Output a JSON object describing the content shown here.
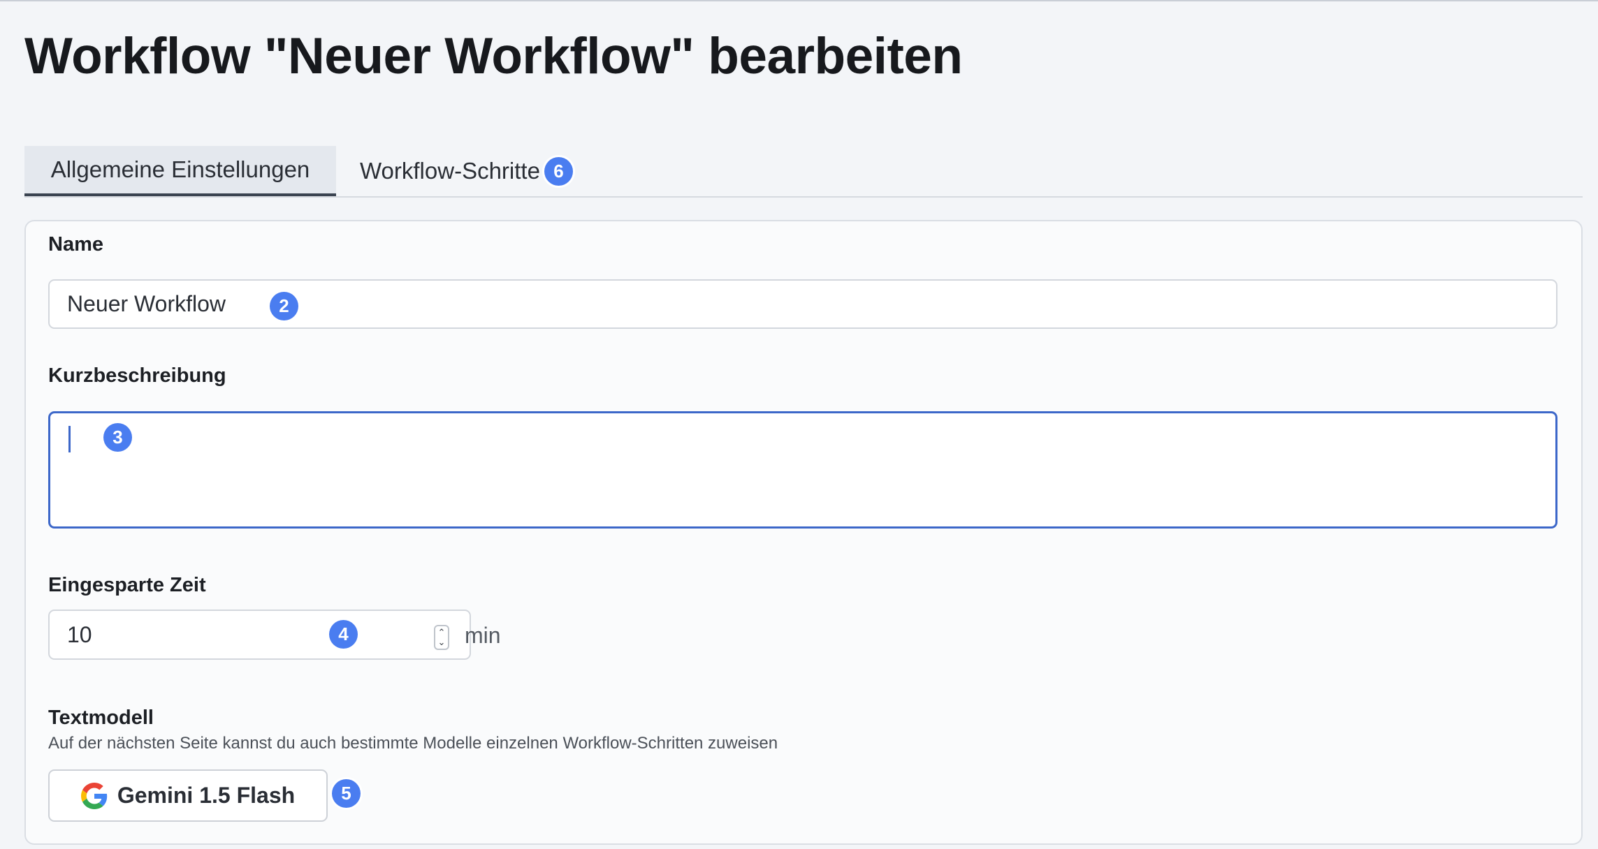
{
  "page": {
    "title": "Workflow \"Neuer Workflow\" bearbeiten"
  },
  "tabs": [
    {
      "label": "Allgemeine Einstellungen",
      "active": true
    },
    {
      "label": "Workflow-Schritte",
      "badge": "6",
      "active": false
    }
  ],
  "form": {
    "name": {
      "label": "Name",
      "value": "Neuer Workflow",
      "badge": "2"
    },
    "description": {
      "label": "Kurzbeschreibung",
      "value": "",
      "badge": "3"
    },
    "saved_time": {
      "label": "Eingesparte Zeit",
      "value": "10",
      "unit": "min",
      "badge": "4"
    },
    "text_model": {
      "label": "Textmodell",
      "hint": "Auf der nächsten Seite kannst du auch bestimmte Modelle einzelnen Workflow-Schritten zuweisen",
      "button_label": "Gemini 1.5 Flash",
      "icon": "google-g-icon",
      "badge": "5"
    }
  },
  "colors": {
    "badge": "#4a7df0",
    "focus": "#3c67c9",
    "background": "#f3f5f8"
  }
}
